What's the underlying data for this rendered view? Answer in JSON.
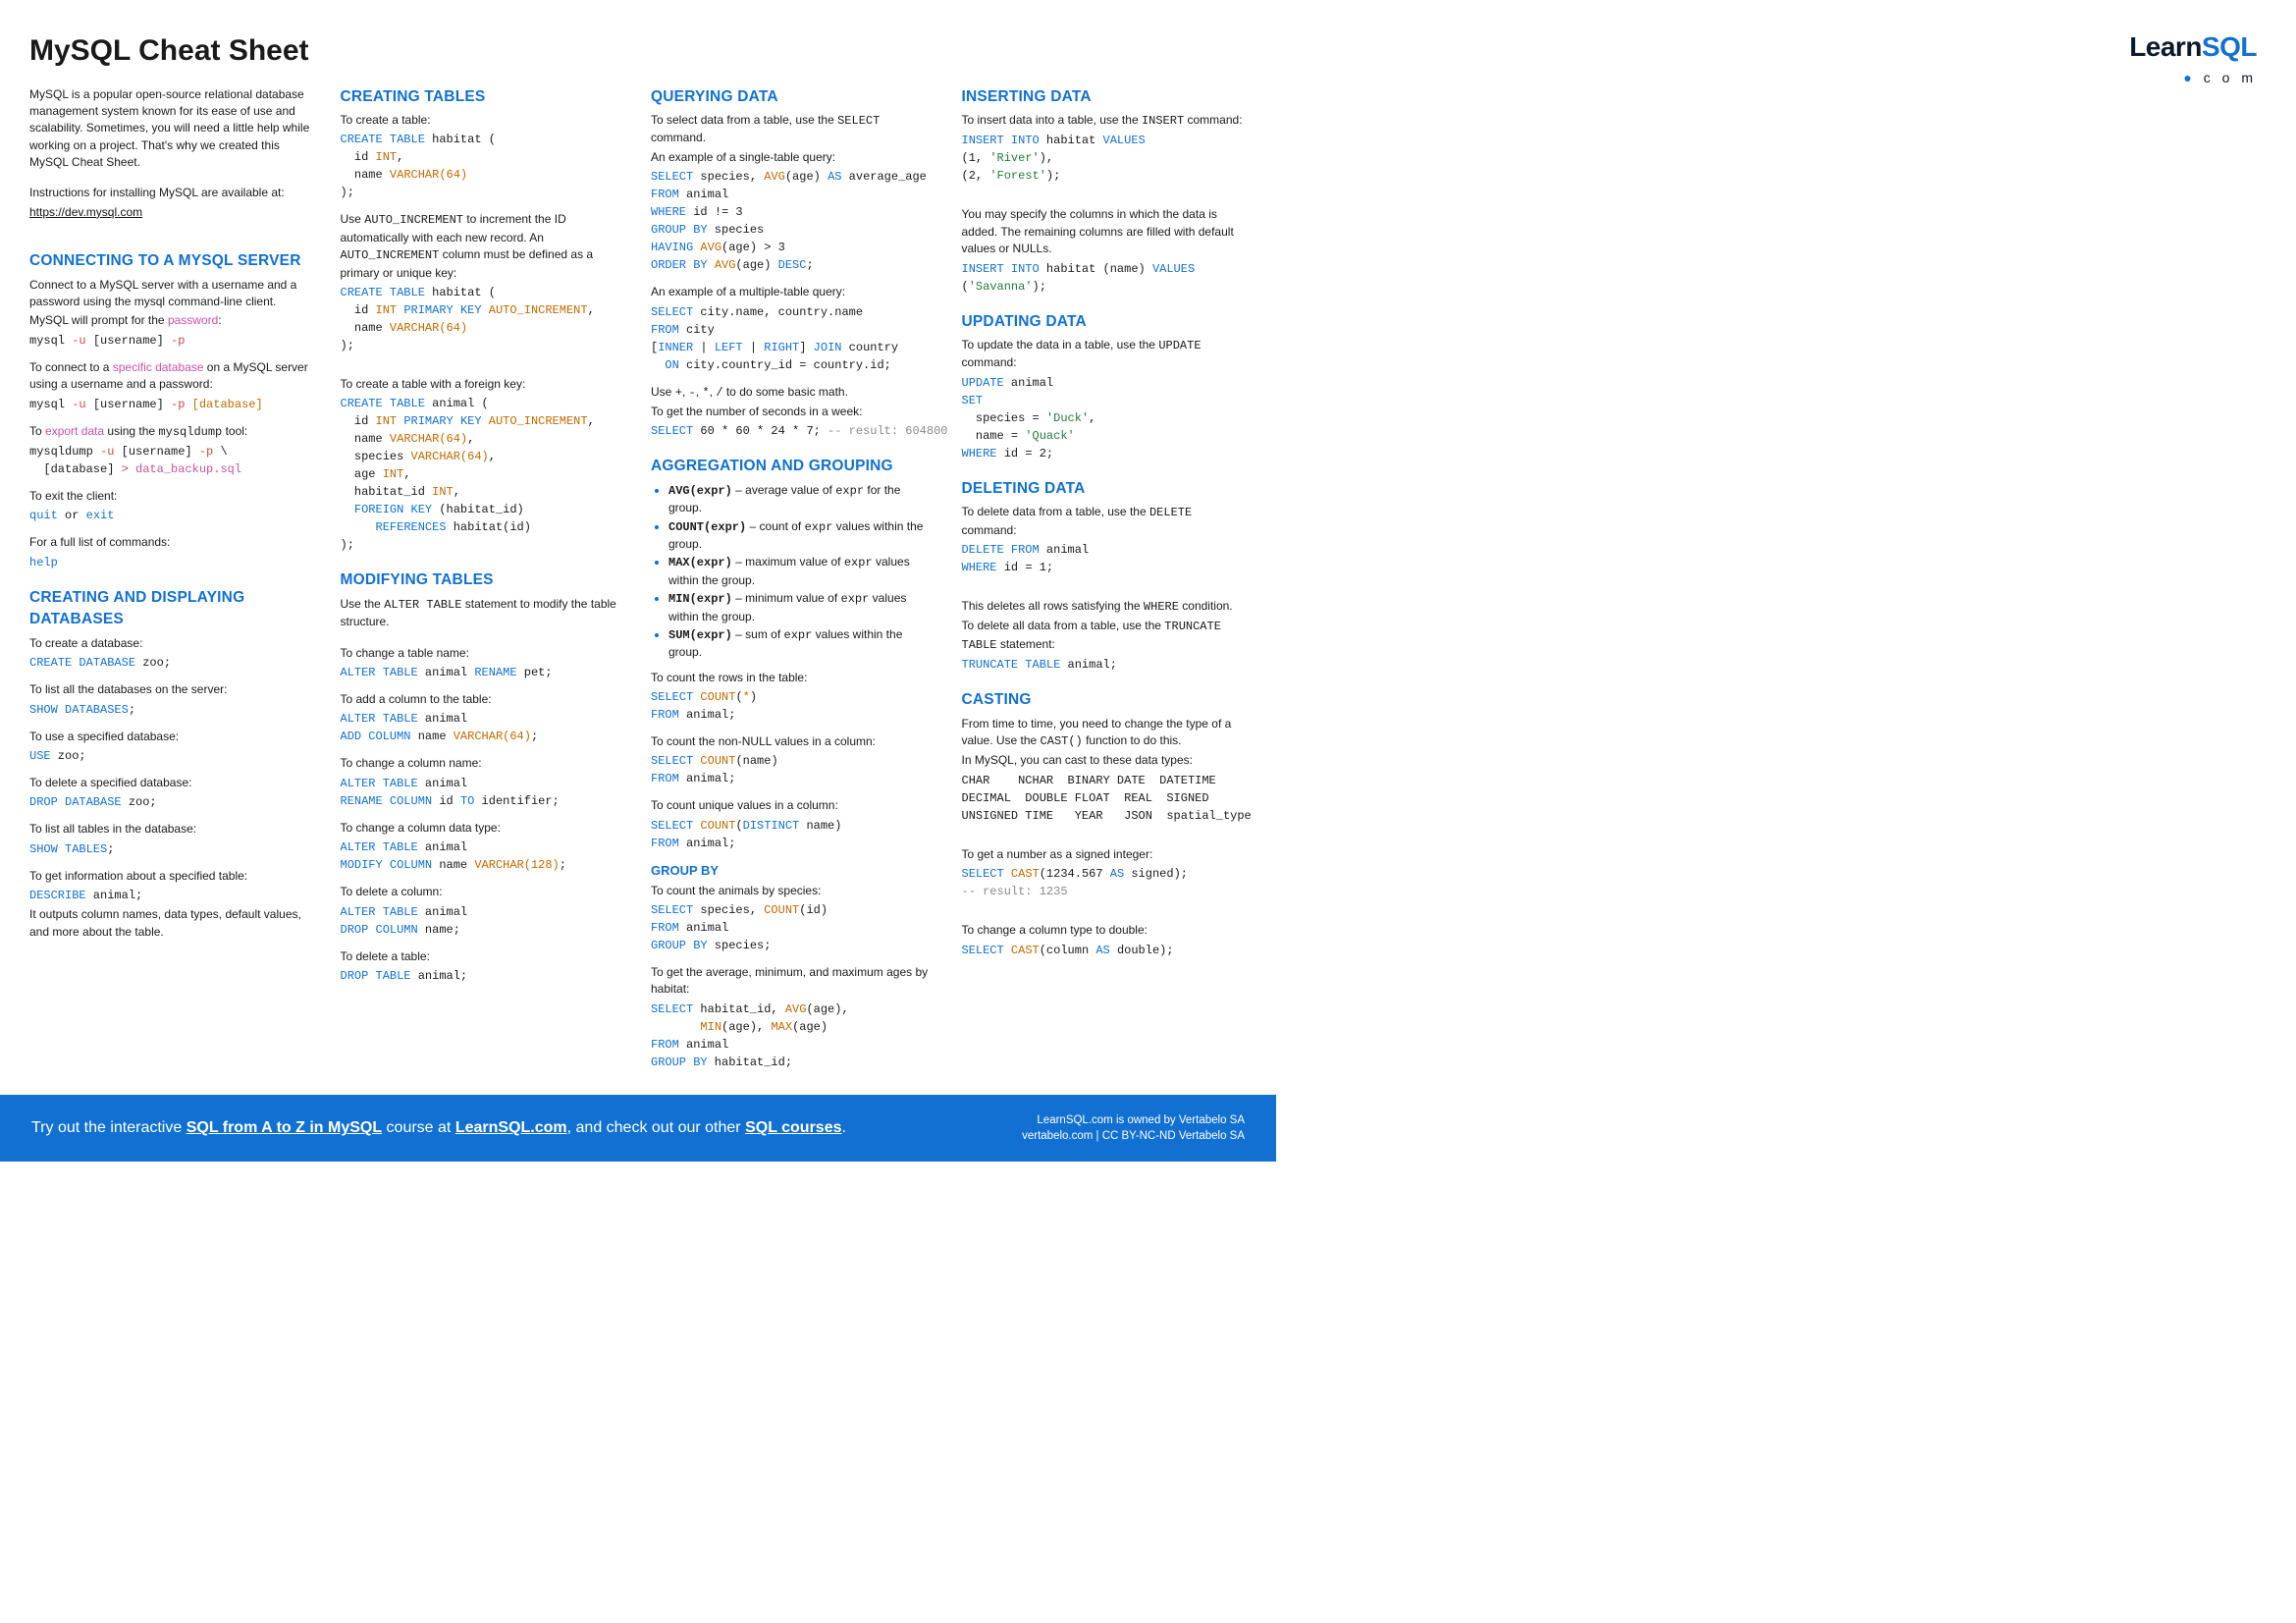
{
  "page": {
    "title": "MySQL Cheat Sheet"
  },
  "logo": {
    "part1": "Learn",
    "part2": "SQL",
    "sub_prefix": "●",
    "sub": " c o m"
  },
  "intro": {
    "p1": "MySQL is a popular open-source relational database management system known for its ease of use and scalability. Sometimes, you will need a little help while working on a project. That's why we created this MySQL Cheat Sheet.",
    "p2_prefix": "Instructions for installing MySQL are available at:",
    "p2_link": "https://dev.mysql.com"
  },
  "sections": {
    "connecting_title": "CONNECTING TO A MYSQL SERVER",
    "creating_db_title": "CREATING AND DISPLAYING DATABASES",
    "creating_tables_title": "CREATING TABLES",
    "modifying_tables_title": "MODIFYING TABLES",
    "querying_title": "QUERYING DATA",
    "agg_title": "AGGREGATION AND GROUPING",
    "groupby_title": "GROUP BY",
    "inserting_title": "INSERTING DATA",
    "updating_title": "UPDATING DATA",
    "deleting_title": "DELETING DATA",
    "casting_title": "CASTING"
  },
  "connect": {
    "p1": "Connect to a MySQL server with a username and a password using the mysql command-line client.",
    "p2a": "MySQL will prompt for the ",
    "p2b": "password",
    "p2c": ":",
    "code1_html": "<span class='mono'>mysql </span><span class='c-red'>-u</span><span class='mono'> [username] </span><span class='c-red'>-p</span>",
    "p3a": "To connect to a ",
    "p3b": "specific database",
    "p3c": " on a MySQL server using a username and a password:",
    "code2_html": "<span class='mono'>mysql </span><span class='c-red'>-u</span><span class='mono'> [username] </span><span class='c-red'>-p</span><span class='mono'> </span><span class='c-type'>[database]</span>",
    "p4a": "To ",
    "p4b": "export data",
    "p4c": " using the ",
    "p4d": "mysqldump",
    "p4e": " tool:",
    "code3_html": "<span class='mono'>mysqldump </span><span class='c-red'>-u</span><span class='mono'> [username] </span><span class='c-red'>-p</span><span class='mono'> \\\n  [database] </span><span class='c-red'>&gt;</span><span class='mono'> </span><span class='c-pink'>data_backup.sql</span>",
    "p5": "To exit the client:",
    "code4_html": "<span class='c-kw'>quit</span><span class='mono'> or </span><span class='c-kw'>exit</span>",
    "p6": "For a full list of commands:",
    "code5_html": "<span class='c-kw'>help</span>"
  },
  "db": {
    "p1": "To create a database:",
    "c1_html": "<span class='c-kw'>CREATE DATABASE</span> zoo;",
    "p2": "To list all the databases on the server:",
    "c2_html": "<span class='c-kw'>SHOW DATABASES</span>;",
    "p3": "To use a specified database:",
    "c3_html": "<span class='c-kw'>USE</span> zoo;",
    "p4": "To delete a specified database:",
    "c4_html": "<span class='c-kw'>DROP DATABASE</span> zoo;",
    "p5": "To list all tables in the database:",
    "c5_html": "<span class='c-kw'>SHOW TABLES</span>;",
    "p6": "To get information about a specified table:",
    "c6_html": "<span class='c-kw'>DESCRIBE</span> animal;",
    "p7": "It outputs column names, data types, default values, and more about the table."
  },
  "tables": {
    "p1": "To create a table:",
    "c1_html": "<span class='c-kw'>CREATE TABLE</span> habitat (\n  id <span class='c-type'>INT</span>,\n  name <span class='c-type'>VARCHAR(64)</span>\n);",
    "p2a": "Use ",
    "p2b": "AUTO_INCREMENT",
    "p2c": " to increment the ID automatically with each new record. An ",
    "p2d": "AUTO_INCREMENT",
    "p2e": " column must be defined as a primary or unique key:",
    "c2_html": "<span class='c-kw'>CREATE TABLE</span> habitat (\n  id <span class='c-type'>INT</span> <span class='c-kw'>PRIMARY KEY</span> <span class='c-type'>AUTO_INCREMENT</span>,\n  name <span class='c-type'>VARCHAR(64)</span>\n);",
    "p3": "To create a table with a foreign key:",
    "c3_html": "<span class='c-kw'>CREATE TABLE</span> animal (\n  id <span class='c-type'>INT</span> <span class='c-kw'>PRIMARY KEY</span> <span class='c-type'>AUTO_INCREMENT</span>,\n  name <span class='c-type'>VARCHAR(64)</span>,\n  species <span class='c-type'>VARCHAR(64)</span>,\n  age <span class='c-type'>INT</span>,\n  habitat_id <span class='c-type'>INT</span>,\n  <span class='c-kw'>FOREIGN KEY</span> (habitat_id)\n     <span class='c-kw'>REFERENCES</span> habitat(id)\n);"
  },
  "modify": {
    "p1a": "Use the ",
    "p1b": "ALTER TABLE",
    "p1c": " statement to modify the table structure.",
    "p2": "To change a table name:",
    "c2_html": "<span class='c-kw'>ALTER TABLE</span> animal <span class='c-kw'>RENAME</span> pet;",
    "p3": "To add a column to the table:",
    "c3_html": "<span class='c-kw'>ALTER TABLE</span> animal\n<span class='c-kw'>ADD COLUMN</span> name <span class='c-type'>VARCHAR(64)</span>;",
    "p4": "To change a column name:",
    "c4_html": "<span class='c-kw'>ALTER TABLE</span> animal\n<span class='c-kw'>RENAME COLUMN</span> id <span class='c-kw'>TO</span> identifier;",
    "p5": "To change a column data type:",
    "c5_html": "<span class='c-kw'>ALTER TABLE</span> animal\n<span class='c-kw'>MODIFY COLUMN</span> name <span class='c-type'>VARCHAR(128)</span>;",
    "p6": "To delete a column:",
    "c6_html": "<span class='c-kw'>ALTER TABLE</span> animal\n<span class='c-kw'>DROP COLUMN</span> name;",
    "p7": "To delete a table:",
    "c7_html": "<span class='c-kw'>DROP TABLE</span> animal;"
  },
  "query": {
    "p1a": "To select data from a table, use the ",
    "p1b": "SELECT",
    "p1c": " command.",
    "p2": "An example of a single-table query:",
    "c1_html": "<span class='c-kw'>SELECT</span> species, <span class='c-fn'>AVG</span>(age) <span class='c-kw'>AS</span> average_age\n<span class='c-kw'>FROM</span> animal\n<span class='c-kw'>WHERE</span> id != 3\n<span class='c-kw'>GROUP BY</span> species\n<span class='c-kw'>HAVING</span> <span class='c-fn'>AVG</span>(age) &gt; 3\n<span class='c-kw'>ORDER BY</span> <span class='c-fn'>AVG</span>(age) <span class='c-kw'>DESC</span>;",
    "p3": "An example of a multiple-table query:",
    "c2_html": "<span class='c-kw'>SELECT</span> city.name, country.name\n<span class='c-kw'>FROM</span> city\n[<span class='c-kw'>INNER</span> | <span class='c-kw'>LEFT</span> | <span class='c-kw'>RIGHT</span>] <span class='c-kw'>JOIN</span> country\n  <span class='c-kw'>ON</span> city.country_id = country.id;",
    "p4a": "Use ",
    "p4b": "+",
    "p4c": ", ",
    "p4d": "-",
    "p4e": ", ",
    "p4f": "*",
    "p4g": ", ",
    "p4h": "/",
    "p4i": " to do some basic math.",
    "p5": "To get the number of seconds in a week:",
    "c3_html": "<span class='c-kw'>SELECT</span> 60 * 60 * 24 * 7; <span class='c-cmt'>-- result: 604800</span>"
  },
  "agg": {
    "items": [
      {
        "fn": "AVG(expr)",
        "desc": " – average value of <span class='mono'>expr</span> for the group."
      },
      {
        "fn": "COUNT(expr)",
        "desc": " – count of <span class='mono'>expr</span> values within the group."
      },
      {
        "fn": "MAX(expr)",
        "desc": " – maximum value of <span class='mono'>expr</span> values within the group."
      },
      {
        "fn": "MIN(expr)",
        "desc": " – minimum value of <span class='mono'>expr</span> values within the group."
      },
      {
        "fn": "SUM(expr)",
        "desc": " – sum of <span class='mono'>expr</span> values within the group."
      }
    ],
    "p1": "To count the rows in the table:",
    "c1_html": "<span class='c-kw'>SELECT</span> <span class='c-fn'>COUNT</span>(<span class='c-type'>*</span>)\n<span class='c-kw'>FROM</span> animal;",
    "p2": "To count the non-NULL values in a column:",
    "c2_html": "<span class='c-kw'>SELECT</span> <span class='c-fn'>COUNT</span>(name)\n<span class='c-kw'>FROM</span> animal;",
    "p3": "To count unique values in a column:",
    "c3_html": "<span class='c-kw'>SELECT</span> <span class='c-fn'>COUNT</span>(<span class='c-kw'>DISTINCT</span> name)\n<span class='c-kw'>FROM</span> animal;"
  },
  "groupby": {
    "p1": "To count the animals by species:",
    "c1_html": "<span class='c-kw'>SELECT</span> species, <span class='c-fn'>COUNT</span>(id)\n<span class='c-kw'>FROM</span> animal\n<span class='c-kw'>GROUP BY</span> species;",
    "p2": "To get the average, minimum, and maximum ages by habitat:",
    "c2_html": "<span class='c-kw'>SELECT</span> habitat_id, <span class='c-fn'>AVG</span>(age),\n       <span class='c-fn'>MIN</span>(age), <span class='c-fn'>MAX</span>(age)\n<span class='c-kw'>FROM</span> animal\n<span class='c-kw'>GROUP BY</span> habitat_id;"
  },
  "insert": {
    "p1a": "To insert data into a table, use the ",
    "p1b": "INSERT",
    "p1c": " command:",
    "c1_html": "<span class='c-kw'>INSERT INTO</span> habitat <span class='c-kw'>VALUES</span>\n(1, <span class='c-str'>'River'</span>),\n(2, <span class='c-str'>'Forest'</span>);",
    "p2": "You may specify the columns in which the data is added. The remaining columns are filled with default values or NULLs.",
    "c2_html": "<span class='c-kw'>INSERT INTO</span> habitat (name) <span class='c-kw'>VALUES</span>\n(<span class='c-str'>'Savanna'</span>);"
  },
  "update": {
    "p1a": "To update the data in a table, use the ",
    "p1b": "UPDATE",
    "p1c": " command:",
    "c1_html": "<span class='c-kw'>UPDATE</span> animal\n<span class='c-kw'>SET</span>\n  species = <span class='c-str'>'Duck'</span>,\n  name = <span class='c-str'>'Quack'</span>\n<span class='c-kw'>WHERE</span> id = 2;"
  },
  "delete": {
    "p1a": "To delete data from a table, use the ",
    "p1b": "DELETE",
    "p1c": " command:",
    "c1_html": "<span class='c-kw'>DELETE FROM</span> animal\n<span class='c-kw'>WHERE</span> id = 1;",
    "p2a": "This deletes all rows satisfying the ",
    "p2b": "WHERE",
    "p2c": " condition.",
    "p3a": "To delete all data from a table, use the ",
    "p3b": "TRUNCATE TABLE",
    "p3c": " statement:",
    "c2_html": "<span class='c-kw'>TRUNCATE TABLE</span> animal;"
  },
  "cast": {
    "p1a": "From time to time, you need to change the type of a value. Use the ",
    "p1b": "CAST()",
    "p1c": " function to do this.",
    "p2": "In MySQL, you can cast to these data types:",
    "types_html": "<span class='mono'>CHAR    NCHAR  BINARY DATE  DATETIME\nDECIMAL  DOUBLE FLOAT  REAL  SIGNED\nUNSIGNED TIME   YEAR   JSON  spatial_type</span>",
    "p3": "To get a number as a signed integer:",
    "c1_html": "<span class='c-kw'>SELECT</span> <span class='c-fn'>CAST</span>(1234.567 <span class='c-kw'>AS</span> signed);\n<span class='c-cmt'>-- result: 1235</span>",
    "p4": "To change a column type to double:",
    "c2_html": "<span class='c-kw'>SELECT</span> <span class='c-fn'>CAST</span>(column <span class='c-kw'>AS</span> double);"
  },
  "footer": {
    "left_html": "Try out the interactive <b>SQL from A to Z in MySQL</b> course at <b>LearnSQL.com</b>, and check out our other <b>SQL courses</b>.",
    "right1": "LearnSQL.com is owned by Vertabelo SA",
    "right2": "vertabelo.com | CC BY-NC-ND Vertabelo SA"
  }
}
